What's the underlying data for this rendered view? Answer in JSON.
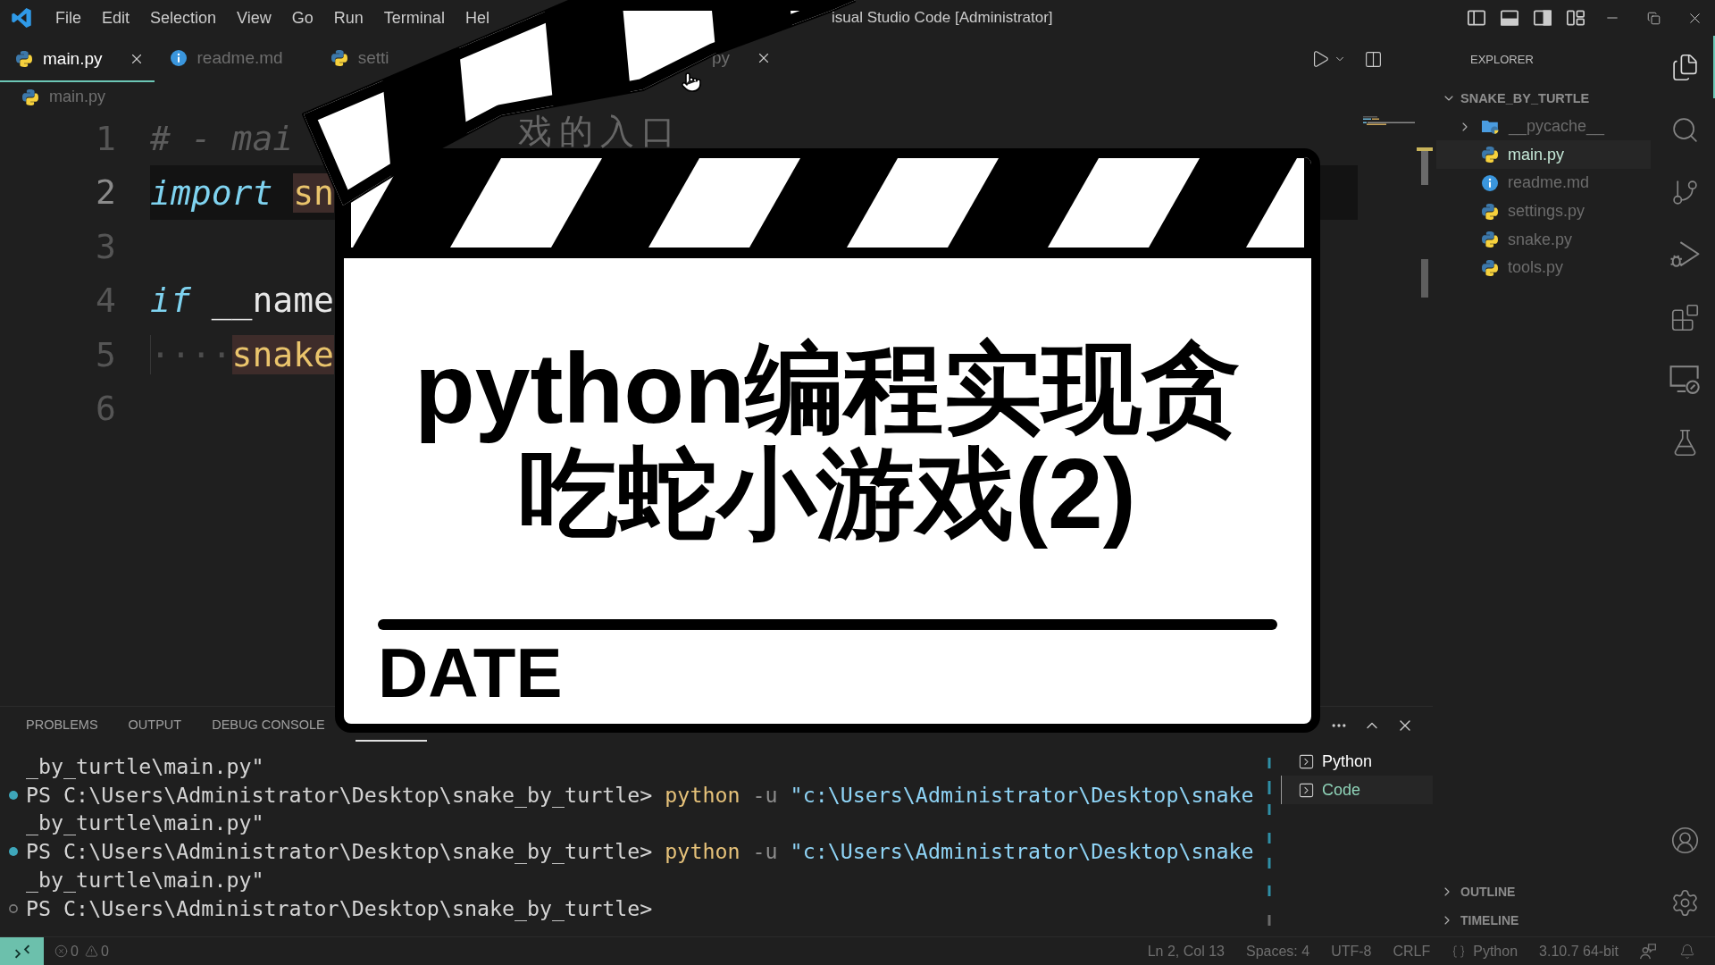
{
  "title_bar": {
    "menu": [
      "File",
      "Edit",
      "Selection",
      "View",
      "Go",
      "Run",
      "Terminal",
      "Hel"
    ],
    "title": "isual Studio Code [Administrator]"
  },
  "editor_tabs": [
    {
      "label": "main.py",
      "kind": "python",
      "selected": true,
      "close": true
    },
    {
      "label": "readme.md",
      "kind": "info",
      "selected": false,
      "close": false
    },
    {
      "label": "setti",
      "kind": "python",
      "selected": false,
      "close": false
    },
    {
      "label": "py",
      "selected": false,
      "close": true
    }
  ],
  "breadcrumb": {
    "kind": "python",
    "label": "main.py"
  },
  "code_lines": [
    {
      "number": "1",
      "current": false,
      "tokens": [
        {
          "kind": "comment",
          "text": "# - mai"
        }
      ],
      "fragment": "戏的入口"
    },
    {
      "number": "2",
      "current": true,
      "tokens": [
        {
          "kind": "keyword",
          "text": "import "
        },
        {
          "kind": "match",
          "text": "sn"
        }
      ]
    },
    {
      "number": "3",
      "current": false
    },
    {
      "number": "4",
      "current": false,
      "tokens": [
        {
          "kind": "keyword",
          "text": "if"
        },
        {
          "kind": "plain",
          "text": " __name"
        }
      ]
    },
    {
      "number": "5",
      "current": false,
      "tokens": [
        {
          "kind": "whitespace",
          "text": "····"
        },
        {
          "kind": "match",
          "text": "snake"
        }
      ]
    },
    {
      "number": "6",
      "current": false
    }
  ],
  "title_card": {
    "title": "python编程实现贪吃蛇小游戏(2)",
    "label": "DATE"
  },
  "panel": {
    "tabs": [
      {
        "label": "PROBLEMS",
        "selected": false
      },
      {
        "label": "OUTPUT",
        "selected": false
      },
      {
        "label": "DEBUG CONSOLE",
        "selected": false
      },
      {
        "selected": true
      }
    ],
    "terminal": [
      {
        "kind": "output",
        "text": "_by_turtle\\main.py\""
      },
      {
        "kind": "command",
        "completed": true,
        "prompt": "PS C:\\Users\\Administrator\\Desktop\\snake_by_turtle>",
        "program": "python",
        "flag": "-u",
        "argument": "\"c:\\Users\\Administrator\\Desktop\\snake"
      },
      {
        "kind": "output",
        "text": "_by_turtle\\main.py\""
      },
      {
        "kind": "command",
        "completed": true,
        "prompt": "PS C:\\Users\\Administrator\\Desktop\\snake_by_turtle>",
        "program": "python",
        "flag": "-u",
        "argument": "\"c:\\Users\\Administrator\\Desktop\\snake"
      },
      {
        "kind": "output",
        "text": "_by_turtle\\main.py\""
      },
      {
        "kind": "command",
        "completed": false,
        "prompt": "PS C:\\Users\\Administrator\\Desktop\\snake_by_turtle>"
      }
    ],
    "sessions": [
      {
        "label": "Python",
        "selected": false
      },
      {
        "label": "Code",
        "selected": true
      }
    ]
  },
  "explorer": {
    "title": "EXPLORER",
    "folder": {
      "label": "SNAKE_BY_TURTLE",
      "expanded": true,
      "children": [
        {
          "label": "__pycache__",
          "kind": "folder",
          "expanded": false,
          "selected": false
        },
        {
          "label": "main.py",
          "kind": "python",
          "selected": true
        },
        {
          "label": "readme.md",
          "kind": "info",
          "selected": false
        },
        {
          "label": "settings.py",
          "kind": "python",
          "selected": false
        },
        {
          "label": "snake.py",
          "kind": "python",
          "selected": false
        },
        {
          "label": "tools.py",
          "kind": "python",
          "selected": false
        }
      ]
    },
    "sections": [
      {
        "label": "OUTLINE",
        "expanded": false
      },
      {
        "label": "TIMELINE",
        "expanded": false
      }
    ]
  },
  "activity_bar": {
    "top": [
      {
        "kind": "files",
        "selected": true
      },
      {
        "kind": "search",
        "selected": false
      },
      {
        "kind": "source_control",
        "selected": false
      },
      {
        "kind": "run_debug",
        "selected": false
      },
      {
        "kind": "extensions",
        "selected": false
      },
      {
        "kind": "remote",
        "selected": false
      },
      {
        "kind": "testing",
        "selected": false
      }
    ],
    "bottom": [
      {
        "kind": "account",
        "selected": false
      },
      {
        "kind": "settings",
        "selected": false
      }
    ]
  },
  "status_bar": {
    "problems": [
      {
        "kind": "error",
        "count": "0"
      },
      {
        "kind": "warning",
        "count": "0"
      }
    ],
    "items": [
      {
        "kind": "text",
        "text": "Ln 2, Col 13"
      },
      {
        "kind": "text",
        "text": "Spaces: 4"
      },
      {
        "kind": "text",
        "text": "UTF-8"
      },
      {
        "kind": "text",
        "text": "CRLF"
      },
      {
        "kind": "language",
        "text": "Python"
      },
      {
        "kind": "text",
        "text": "3.10.7 64-bit"
      }
    ]
  }
}
